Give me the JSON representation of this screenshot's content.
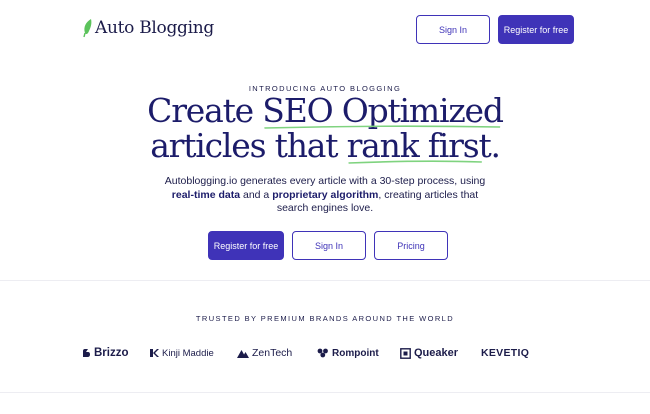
{
  "header": {
    "logo_text": "Auto Blogging",
    "signin_label": "Sign In",
    "register_label": "Register for free"
  },
  "hero": {
    "eyebrow": "INTRODUCING AUTO BLOGGING",
    "headline_line1_pre": "Create ",
    "headline_line1_highlight": "SEO Optimized",
    "headline_line2_pre": "articles that ",
    "headline_line2_highlight": "rank first.",
    "sub_part1": "Autoblogging.io generates every article with a 30-step process, using ",
    "sub_bold1": "real-time data",
    "sub_part2": " and a ",
    "sub_bold2": "proprietary algorithm",
    "sub_part3": ", creating articles that search engines love.",
    "cta_register": "Register for free",
    "cta_signin": "Sign In",
    "cta_pricing": "Pricing"
  },
  "trusted": {
    "title": "TRUSTED BY PREMIUM BRANDS AROUND THE WORLD",
    "brands": [
      {
        "name": "Brizzo",
        "icon": "brizzo-logo-icon"
      },
      {
        "name": "Kinji Maddie",
        "icon": "kinji-logo-icon"
      },
      {
        "name": "ZenTech",
        "icon": "zentech-logo-icon"
      },
      {
        "name": "Rompoint",
        "icon": "rompoint-logo-icon"
      },
      {
        "name": "Queaker",
        "icon": "queaker-logo-icon"
      },
      {
        "name": "KEVETIQ",
        "icon": ""
      }
    ]
  },
  "colors": {
    "primary": "#3f33b8",
    "heading": "#1c1c6a",
    "underline": "#7fd37f"
  }
}
